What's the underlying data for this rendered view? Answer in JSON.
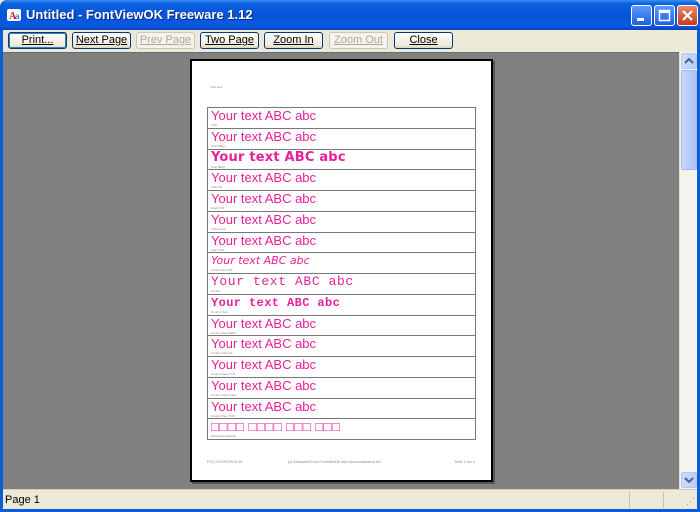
{
  "window": {
    "title": "Untitled - FontViewOK Freeware 1.12"
  },
  "toolbar": {
    "print": "Print...",
    "next_page": "Next Page",
    "prev_page": "Prev Page",
    "two_page": "Two Page",
    "zoom_in": "Zoom In",
    "zoom_out": "Zoom Out",
    "close": "Close"
  },
  "page": {
    "header": "Your text",
    "sample_text": "Your text ABC abc",
    "rows": [
      {
        "sample": "Your text ABC abc",
        "font": "Arial"
      },
      {
        "sample": "Your text ABC abc",
        "font": "Arial Baltic"
      },
      {
        "sample": "Your text ABC abc",
        "font": "Arial Black"
      },
      {
        "sample": "Your text ABC abc",
        "font": "Arial CE"
      },
      {
        "sample": "Your text ABC abc",
        "font": "Arial CYR"
      },
      {
        "sample": "Your text ABC abc",
        "font": "Arial Greek"
      },
      {
        "sample": "Your text ABC abc",
        "font": "Arial TUR"
      },
      {
        "sample": "Your text ABC abc",
        "font": "Comic Sans MS"
      },
      {
        "sample": "Your text ABC abc",
        "font": "Courier"
      },
      {
        "sample": "Your text ABC abc",
        "font": "Courier New"
      },
      {
        "sample": "Your text ABC abc",
        "font": "Courier New Baltic"
      },
      {
        "sample": "Your text ABC abc",
        "font": "Courier New CE"
      },
      {
        "sample": "Your text ABC abc",
        "font": "Courier New CYR"
      },
      {
        "sample": "Your text ABC abc",
        "font": "Courier New Greek"
      },
      {
        "sample": "Your text ABC abc",
        "font": "Courier New TUR"
      },
      {
        "sample": "□□□□ □□□□ □□□ □□□",
        "font": "Estrangelo Edessa"
      }
    ],
    "footer_left": "FVO 22/2009 09:31:50",
    "footer_mid": "(c) SoftwareOK.com FontViewOK http://www.softwareok.de/",
    "footer_right": "Seite 1 von 4"
  },
  "status": {
    "text": "Page 1"
  },
  "colors": {
    "sample": "#e6209a",
    "titlebar": "#0853d6",
    "preview_bg": "#808080"
  }
}
